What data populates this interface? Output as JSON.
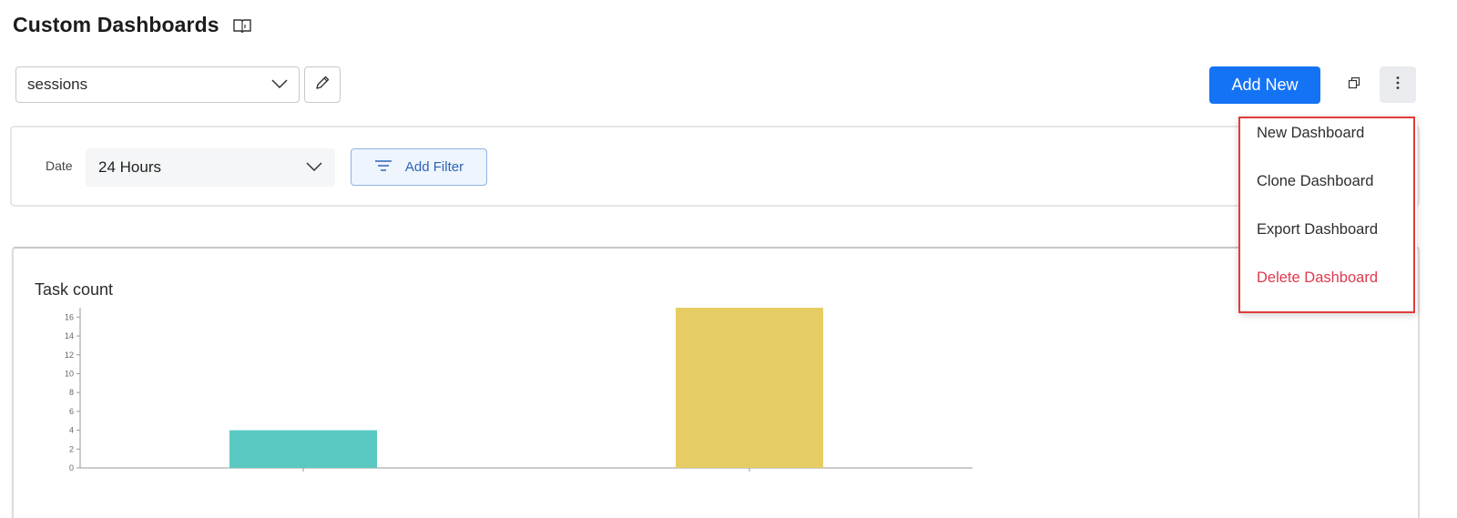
{
  "header": {
    "title": "Custom Dashboards",
    "help_icon": "book-icon"
  },
  "toolbar": {
    "dashboard_selected": "sessions",
    "edit_icon": "pencil-icon",
    "add_new_label": "Add New",
    "window_icon": "restore-window-icon",
    "more_icon": "kebab-menu-icon"
  },
  "filters": {
    "date_label": "Date",
    "date_value": "24 Hours",
    "add_filter_label": "Add Filter"
  },
  "menu": {
    "items": [
      {
        "label": "New Dashboard"
      },
      {
        "label": "Clone Dashboard"
      },
      {
        "label": "Export Dashboard"
      },
      {
        "label": "Delete Dashboard"
      }
    ]
  },
  "colors": {
    "primary": "#1473f5",
    "danger": "#de3a4f",
    "highlight": "#e23b3b"
  },
  "chart_data": {
    "type": "bar",
    "title": "Task count",
    "categories": [
      "",
      ""
    ],
    "values": [
      4,
      17
    ],
    "colors": [
      "#59c9c1",
      "#e5cd63"
    ],
    "ylim": [
      0,
      17
    ],
    "yticks": [
      0,
      2,
      4,
      6,
      8,
      10,
      12,
      14,
      16
    ],
    "xlabel": "",
    "ylabel": ""
  }
}
